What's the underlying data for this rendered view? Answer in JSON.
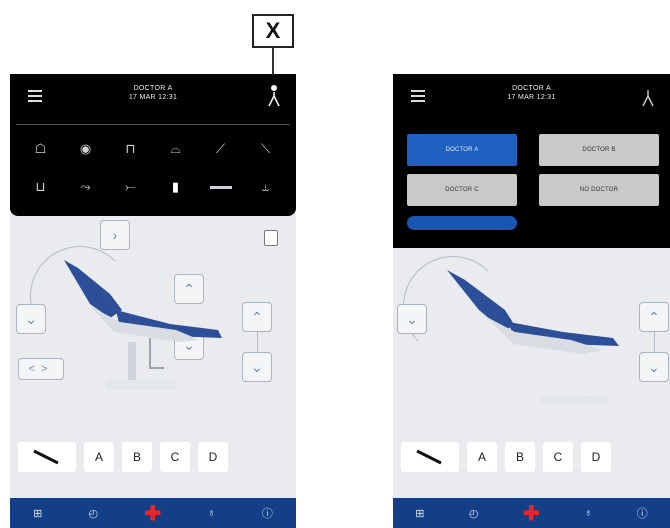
{
  "callout": {
    "label": "X"
  },
  "left_screen": {
    "header": {
      "user_name": "DOCTOR A",
      "datetime": "17 MAR 12:31"
    },
    "icon_panel": {
      "row1": [
        "lamp-icon",
        "eye-icon",
        "cup-icon",
        "basin-fill-icon",
        "chair-position-1-icon",
        "chair-position-2-icon"
      ],
      "row2": [
        "cup-fill-icon",
        "water-spray-icon",
        "air-spray-icon",
        "bottle-icon",
        "bar-icon",
        "chair-reset-icon"
      ]
    },
    "tools": [
      "A",
      "B",
      "C",
      "D"
    ],
    "controls": {
      "backrest_left": "<",
      "backrest_right": ">"
    }
  },
  "right_screen": {
    "header": {
      "user_name": "DOCTOR A",
      "datetime": "17 MAR 12:31"
    },
    "doctors": [
      {
        "label": "DOCTOR A",
        "selected": true
      },
      {
        "label": "DOCTOR B",
        "selected": false
      },
      {
        "label": "DOCTOR C",
        "selected": false
      },
      {
        "label": "NO DOCTOR",
        "selected": false
      }
    ],
    "tools": [
      "A",
      "B",
      "C",
      "D"
    ]
  },
  "bottom_bar": {
    "items": [
      "settings-icon",
      "timer-icon",
      "emergency-cross-icon",
      "microphone-icon",
      "info-icon"
    ]
  },
  "colors": {
    "accent": "#123f86",
    "selected": "#1f5fbf",
    "emergency": "#e5262b"
  }
}
